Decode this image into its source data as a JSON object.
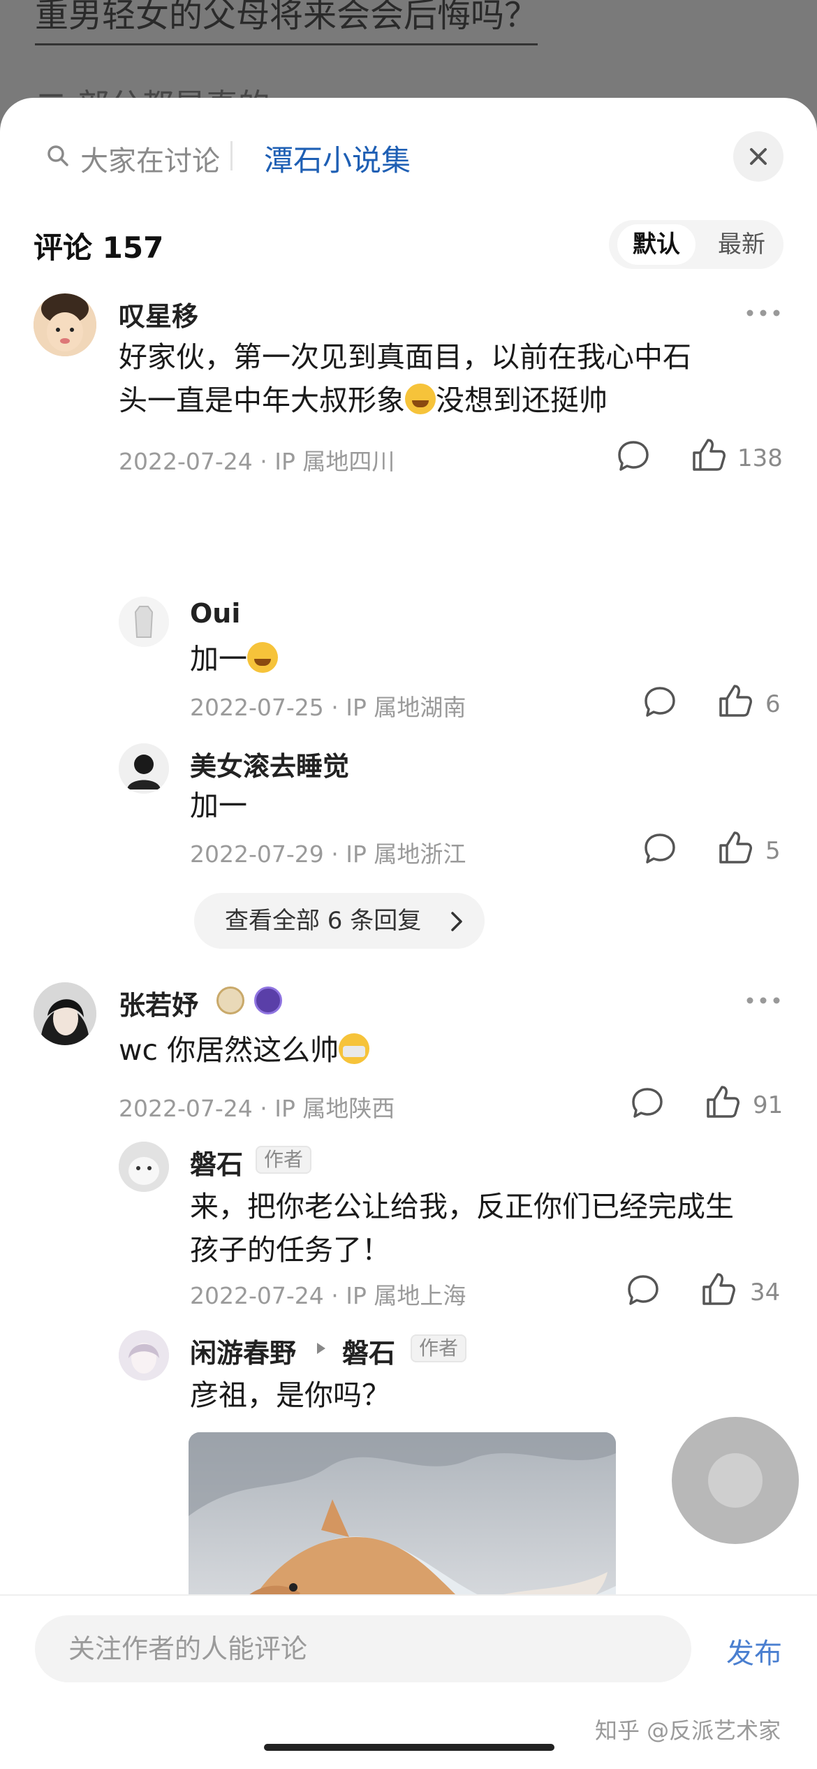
{
  "background": {
    "title": "重男轻女的父母将来会会后悔吗？",
    "line2": "二 部分都是真的"
  },
  "header": {
    "discuss_label": "大家在讨论",
    "source_label": "潭石小说集"
  },
  "comments_header": {
    "count_label": "评论 157",
    "sort_default": "默认",
    "sort_newest": "最新"
  },
  "comments": [
    {
      "name": "叹星移",
      "text_1": "好家伙，第一次见到真面目，以前在我心中石",
      "text_2": "头一直是中年大叔形象",
      "text_3": "没想到还挺帅",
      "meta": "2022-07-24 · IP 属地四川",
      "likes": "138",
      "replies": [
        {
          "name": "Oui",
          "text": "加一",
          "meta": "2022-07-25 · IP 属地湖南",
          "likes": "6"
        },
        {
          "name": "美女滚去睡觉",
          "text": "加一",
          "meta": "2022-07-29 · IP 属地浙江",
          "likes": "5"
        }
      ],
      "view_all": "查看全部 6 条回复"
    },
    {
      "name": "张若妤",
      "text": "wc 你居然这么帅",
      "meta": "2022-07-24 · IP 属地陕西",
      "likes": "91",
      "replies": [
        {
          "name": "磐石",
          "tag": "作者",
          "text_1": "来，把你老公让给我，反正你们已经完成生",
          "text_2": "孩子的任务了！",
          "meta": "2022-07-24 · IP 属地上海",
          "likes": "34"
        },
        {
          "name": "闲游春野",
          "reply_to": "磐石",
          "tag": "作者",
          "text": "彦祖，是你吗？"
        }
      ]
    }
  ],
  "bottom": {
    "input_placeholder": "关注作者的人能评论",
    "publish_label": "发布",
    "watermark": "知乎 @反派艺术家"
  },
  "colors": {
    "accent_blue": "#1e5fb4",
    "publish_blue": "#4a7fd0",
    "meta_gray": "#9a9a9a"
  }
}
